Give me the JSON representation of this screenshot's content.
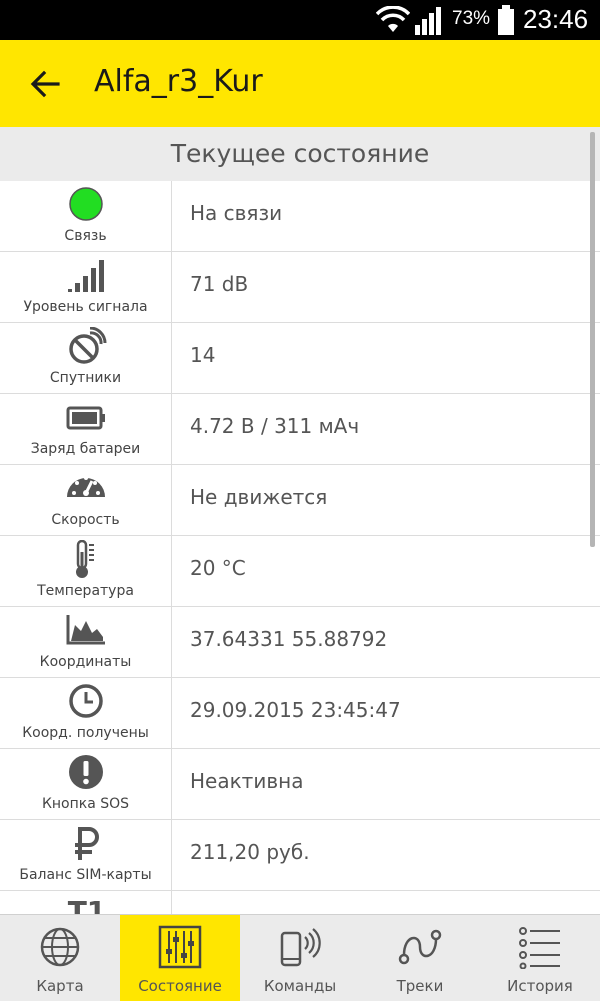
{
  "status_bar": {
    "battery": "73%",
    "time": "23:46"
  },
  "app_bar": {
    "title": "Alfa_r3_Kur"
  },
  "section": {
    "title": "Текущее состояние"
  },
  "rows": [
    {
      "label": "Связь",
      "value": "На связи",
      "icon": "connection-status-icon"
    },
    {
      "label": "Уровень сигнала",
      "value": "71 dB",
      "icon": "signal-bars-icon"
    },
    {
      "label": "Спутники",
      "value": "14",
      "icon": "satellite-dish-icon"
    },
    {
      "label": "Заряд батареи",
      "value": "4.72 В / 311 мАч",
      "icon": "battery-icon"
    },
    {
      "label": "Скорость",
      "value": "Не движется",
      "icon": "speedometer-icon"
    },
    {
      "label": "Температура",
      "value": "20 °C",
      "icon": "thermometer-icon"
    },
    {
      "label": "Координаты",
      "value": "37.64331  55.88792",
      "icon": "area-chart-icon"
    },
    {
      "label": "Коорд. получены",
      "value": "29.09.2015 23:45:47",
      "icon": "clock-icon"
    },
    {
      "label": "Кнопка SOS",
      "value": "Неактивна",
      "icon": "alert-icon"
    },
    {
      "label": "Баланс SIM-карты",
      "value": "211,20 руб.",
      "icon": "ruble-icon"
    },
    {
      "label": "",
      "value": "",
      "icon": "t1-icon",
      "glyph": "T1"
    }
  ],
  "colors": {
    "accent": "#ffe600",
    "connected": "#22dd22"
  },
  "bottom_nav": [
    {
      "label": "Карта",
      "icon": "globe-icon",
      "active": false
    },
    {
      "label": "Состояние",
      "icon": "sliders-icon",
      "active": true
    },
    {
      "label": "Команды",
      "icon": "phone-signal-icon",
      "active": false
    },
    {
      "label": "Треки",
      "icon": "route-icon",
      "active": false
    },
    {
      "label": "История",
      "icon": "list-icon",
      "active": false
    }
  ]
}
